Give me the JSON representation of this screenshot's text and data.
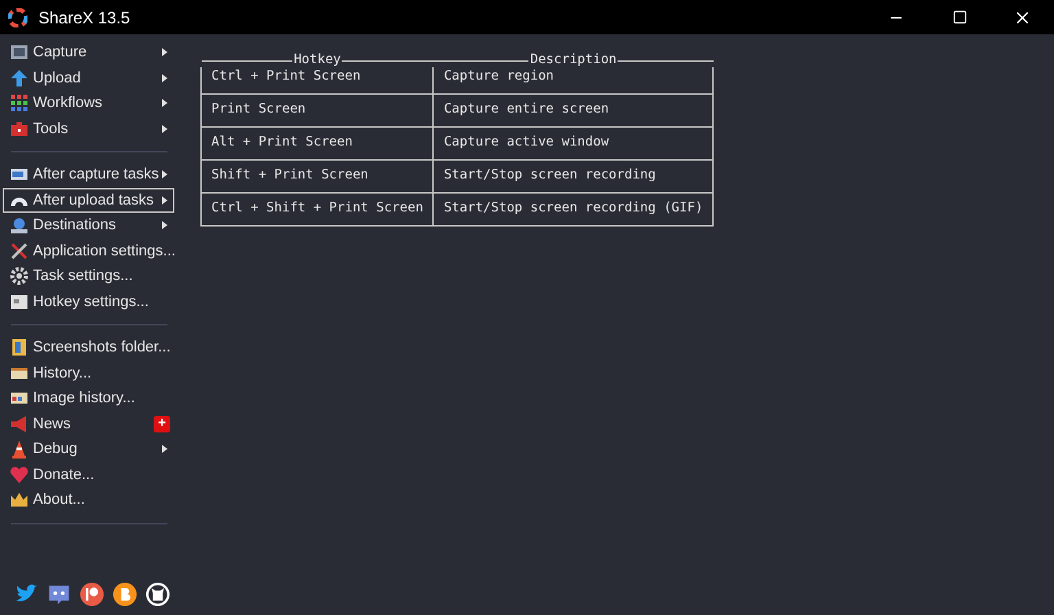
{
  "window": {
    "title": "ShareX 13.5"
  },
  "menu": [
    {
      "kind": "item",
      "label": "Capture",
      "submenu": true,
      "selected": false
    },
    {
      "kind": "item",
      "label": "Upload",
      "submenu": true,
      "selected": false
    },
    {
      "kind": "item",
      "label": "Workflows",
      "submenu": true,
      "selected": false
    },
    {
      "kind": "item",
      "label": "Tools",
      "submenu": true,
      "selected": false
    },
    {
      "kind": "separator"
    },
    {
      "kind": "item",
      "label": "After capture tasks",
      "submenu": true,
      "selected": false
    },
    {
      "kind": "item",
      "label": "After upload tasks",
      "submenu": true,
      "selected": true
    },
    {
      "kind": "item",
      "label": "Destinations",
      "submenu": true,
      "selected": false
    },
    {
      "kind": "item",
      "label": "Application settings...",
      "submenu": false,
      "selected": false
    },
    {
      "kind": "item",
      "label": "Task settings...",
      "submenu": false,
      "selected": false
    },
    {
      "kind": "item",
      "label": "Hotkey settings...",
      "submenu": false,
      "selected": false
    },
    {
      "kind": "separator"
    },
    {
      "kind": "item",
      "label": "Screenshots folder...",
      "submenu": false,
      "selected": false
    },
    {
      "kind": "item",
      "label": "History...",
      "submenu": false,
      "selected": false
    },
    {
      "kind": "item",
      "label": "Image history...",
      "submenu": false,
      "selected": false
    },
    {
      "kind": "item",
      "label": "News",
      "submenu": false,
      "selected": false,
      "badge": "+"
    },
    {
      "kind": "item",
      "label": "Debug",
      "submenu": true,
      "selected": false
    },
    {
      "kind": "item",
      "label": "Donate...",
      "submenu": false,
      "selected": false
    },
    {
      "kind": "item",
      "label": "About...",
      "submenu": false,
      "selected": false
    },
    {
      "kind": "separator"
    }
  ],
  "table": {
    "columns": [
      "Hotkey",
      "Description"
    ],
    "rows": [
      [
        "Ctrl + Print Screen",
        "Capture region"
      ],
      [
        "Print Screen",
        "Capture entire screen"
      ],
      [
        "Alt + Print Screen",
        "Capture active window"
      ],
      [
        "Shift + Print Screen",
        "Start/Stop screen recording"
      ],
      [
        "Ctrl + Shift + Print Screen",
        "Start/Stop screen recording (GIF)"
      ]
    ]
  }
}
